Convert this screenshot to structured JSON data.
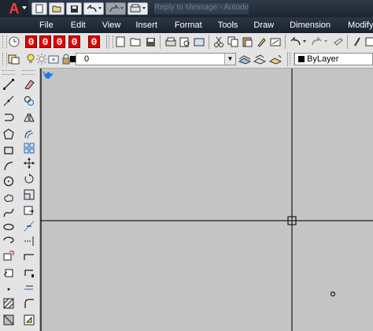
{
  "app": {
    "logo_letter": "A",
    "title_text": "Reply to Message - Autodesk"
  },
  "quick_access": [
    {
      "name": "new-icon",
      "glyph": "▭"
    },
    {
      "name": "open-icon",
      "glyph": "📂"
    },
    {
      "name": "save-icon",
      "glyph": "💾"
    },
    {
      "name": "undo-icon",
      "glyph": "↶"
    },
    {
      "name": "redo-icon",
      "glyph": "↷"
    },
    {
      "name": "plot-icon",
      "glyph": "🖶"
    }
  ],
  "menu": [
    "File",
    "Edit",
    "View",
    "Insert",
    "Format",
    "Tools",
    "Draw",
    "Dimension",
    "Modify"
  ],
  "counter": {
    "digits": [
      "0",
      "0",
      "0",
      "0",
      "0"
    ],
    "color": "#e20000"
  },
  "layer": {
    "current": "0",
    "color_swatch": "#000000"
  },
  "properties": {
    "color_value": "ByLayer"
  },
  "colors": {
    "titlebar": "#1d2530",
    "accent_red": "#e20000",
    "canvas": "#c4c4c4",
    "crosshair": "#1a1a1a"
  }
}
